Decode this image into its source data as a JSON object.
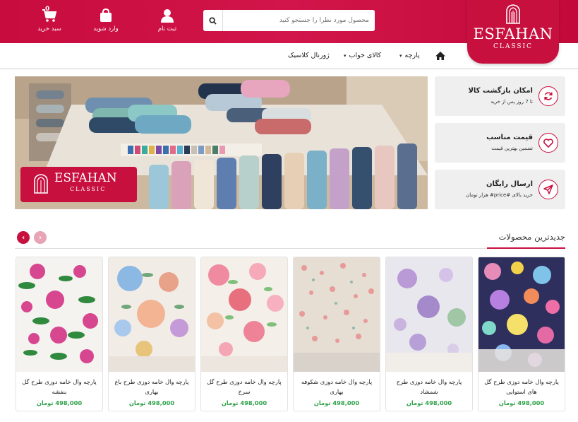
{
  "header": {
    "logo_name": "ESFAHAN",
    "logo_sub": "CLASSIC",
    "search_placeholder": "محصول مورد نظرا را جستجو کنید",
    "register_label": "ثبت نام",
    "login_label": "وارد شوید",
    "cart_label": "سبد خرید",
    "cart_count": "0"
  },
  "nav": {
    "items": [
      {
        "label": "پارچه"
      },
      {
        "label": "کالای خواب"
      },
      {
        "label": "ژورنال کلاسیک"
      }
    ]
  },
  "hero": {
    "logo_name": "ESFAHAN",
    "logo_sub": "CLASSIC"
  },
  "features": [
    {
      "title": "امکان بازگشت کالا",
      "subtitle": "تا 7 روز پس از خرید",
      "icon": "refresh-icon"
    },
    {
      "title": "قیمت مناسب",
      "subtitle": "تضمین بهترین قیمت",
      "icon": "heart-icon"
    },
    {
      "title": "ارسال رایگان",
      "subtitle": "خرید بالای #price# هزار تومان",
      "icon": "send-icon"
    }
  ],
  "section": {
    "title": "جدیدترین محصولات"
  },
  "products": [
    {
      "name": "پارچه وال خامه دوزی طرح گل های استوایی",
      "price": "498,000 تومان"
    },
    {
      "name": "پارچه وال خامه دوزی طرح شمشاد",
      "price": "498,000 تومان"
    },
    {
      "name": "پارچه وال خامه دوزی شکوفه بهاری",
      "price": "498,000 تومان"
    },
    {
      "name": "پارچه وال خامه دوزی طرح گل سرخ",
      "price": "498,000 تومان"
    },
    {
      "name": "پارچه وال خامه دوزی طرح باغ بهاری",
      "price": "498,000 تومان"
    },
    {
      "name": "پارچه وال خامه دوزی طرح گل بنفشه",
      "price": "498,000 تومان"
    }
  ],
  "colors": {
    "brand": "#c8103f",
    "price": "#2fa24a"
  }
}
